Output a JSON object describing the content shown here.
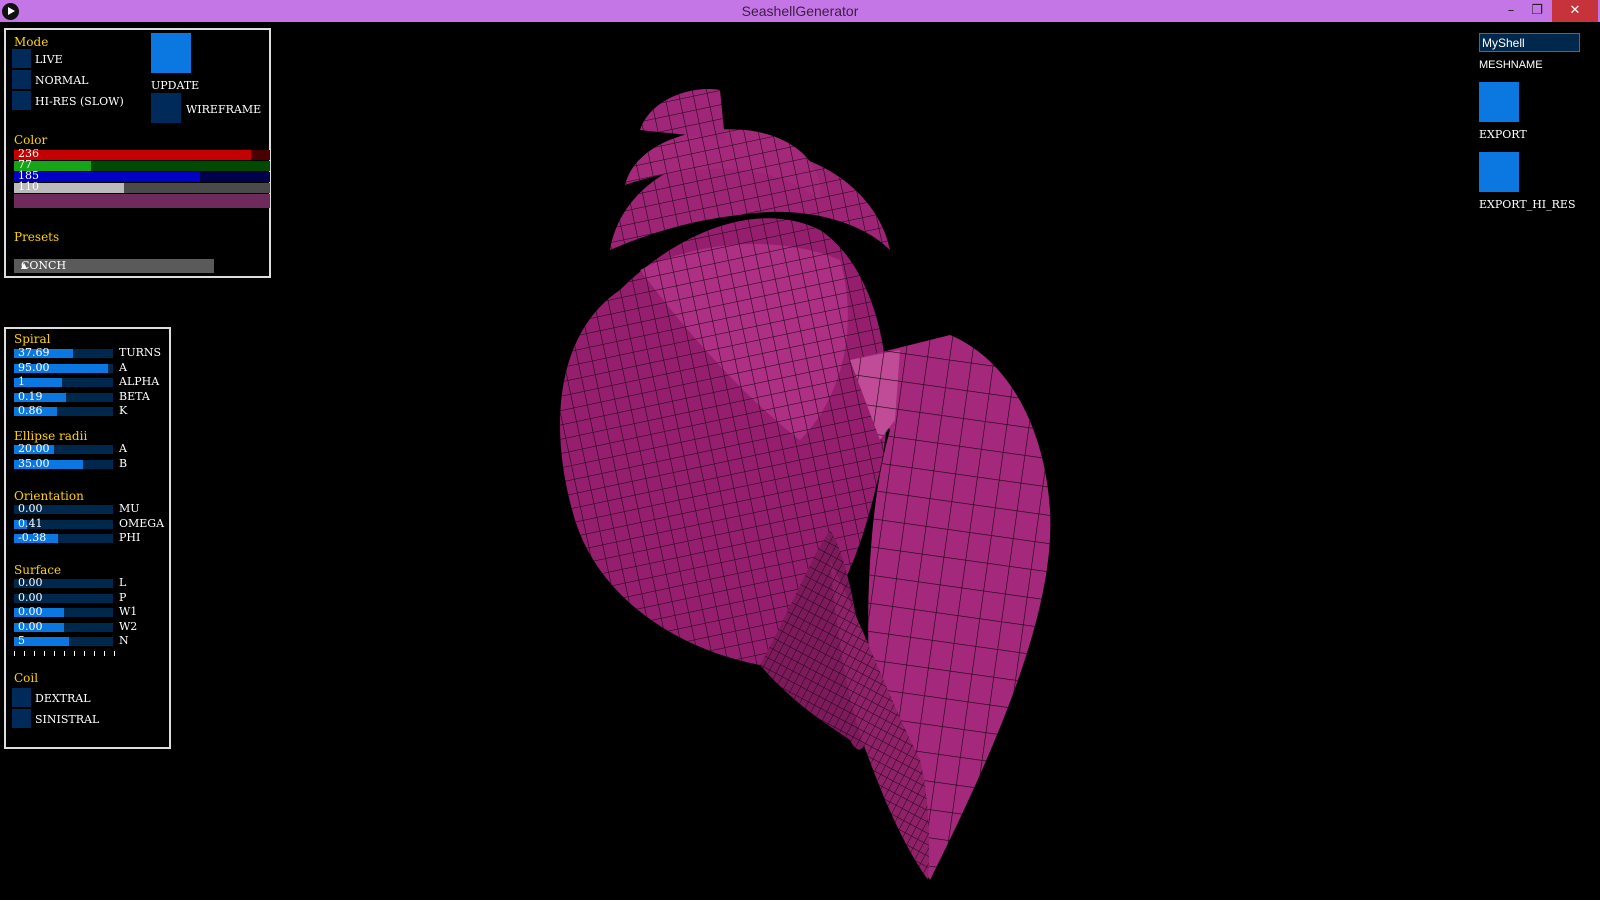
{
  "window": {
    "title": "SeashellGenerator"
  },
  "mode": {
    "heading": "Mode",
    "options": [
      "LIVE",
      "NORMAL",
      "HI-RES (SLOW)"
    ],
    "update_label": "UPDATE",
    "wireframe_label": "WIREFRAME"
  },
  "color": {
    "heading": "Color",
    "r": "236",
    "g": "77",
    "b": "185",
    "a": "110",
    "r_level": 0.926,
    "g_level": 0.302,
    "b_level": 0.725,
    "a_level": 0.431,
    "swatch": "#6e2a5a"
  },
  "presets": {
    "heading": "Presets",
    "selected": "CONCH"
  },
  "spiral": {
    "heading": "Spiral",
    "sliders": [
      {
        "value": "37.69",
        "label": "TURNS",
        "level": 0.6
      },
      {
        "value": "95.00",
        "label": "A",
        "level": 0.95
      },
      {
        "value": "1",
        "label": "ALPHA",
        "level": 0.48
      },
      {
        "value": "0.19",
        "label": "BETA",
        "level": 0.53
      },
      {
        "value": "0.86",
        "label": "K",
        "level": 0.43
      }
    ]
  },
  "ellipse": {
    "heading": "Ellipse radii",
    "sliders": [
      {
        "value": "20.00",
        "label": "A",
        "level": 0.4
      },
      {
        "value": "35.00",
        "label": "B",
        "level": 0.7
      }
    ]
  },
  "orientation": {
    "heading": "Orientation",
    "sliders": [
      {
        "value": "0.00",
        "label": "MU",
        "level": 0.0
      },
      {
        "value": "0.41",
        "label": "OMEGA",
        "level": 0.13
      },
      {
        "value": "-0.38",
        "label": "PHI",
        "level": 0.44
      }
    ]
  },
  "surface": {
    "heading": "Surface",
    "sliders": [
      {
        "value": "0.00",
        "label": "L",
        "level": 0.0
      },
      {
        "value": "0.00",
        "label": "P",
        "level": 0.0
      },
      {
        "value": "0.00",
        "label": "W1",
        "level": 0.5
      },
      {
        "value": "0.00",
        "label": "W2",
        "level": 0.5
      },
      {
        "value": "5",
        "label": "N",
        "level": 0.56
      }
    ]
  },
  "coil": {
    "heading": "Coil",
    "options": [
      "DEXTRAL",
      "SINISTRAL"
    ]
  },
  "export": {
    "meshname_value": "MyShell",
    "meshname_label": "MESHNAME",
    "export_label": "EXPORT",
    "export_hi_res_label": "EXPORT_HI_RES"
  },
  "colors": {
    "accent": "#0a78e0",
    "heading": "#ffd200",
    "shell": "#9c2a78"
  }
}
